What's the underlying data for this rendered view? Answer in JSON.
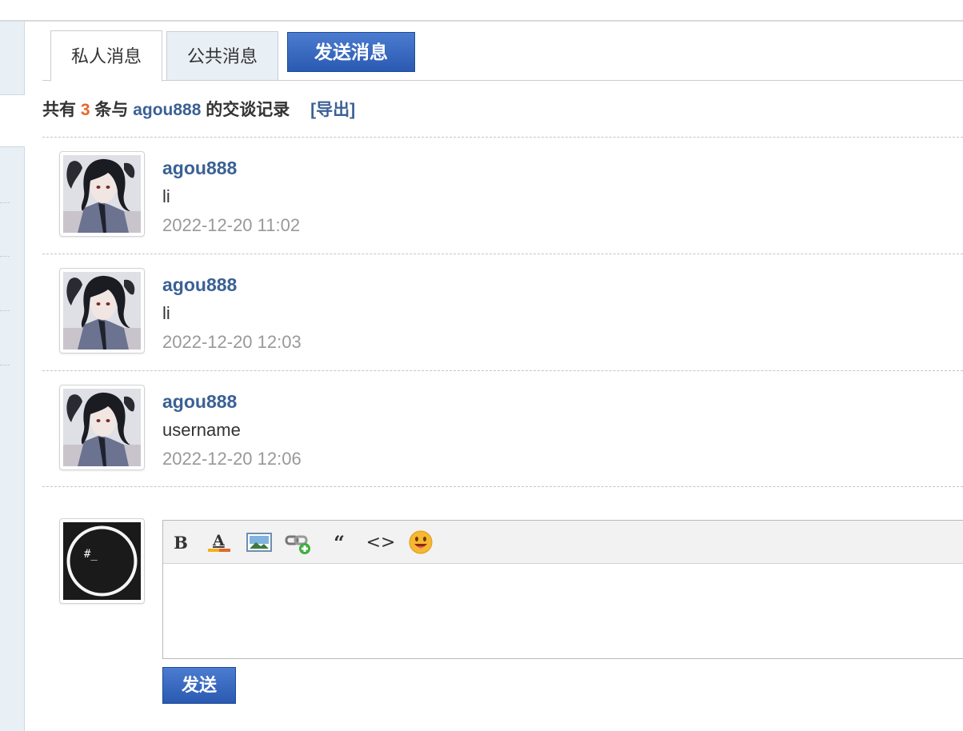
{
  "tabs": {
    "private": "私人消息",
    "public": "公共消息",
    "send_message": "发送消息"
  },
  "summary": {
    "prefix": "共有",
    "count": "3",
    "middle": "条与",
    "username": "agou888",
    "suffix": "的交谈记录",
    "export_label": "[导出]"
  },
  "messages": [
    {
      "author": "agou888",
      "text": "li",
      "time": "2022-12-20 11:02"
    },
    {
      "author": "agou888",
      "text": "li",
      "time": "2022-12-20 12:03"
    },
    {
      "author": "agou888",
      "text": "username",
      "time": "2022-12-20 12:06"
    }
  ],
  "my_avatar": {
    "text": "#_"
  },
  "editor": {
    "toolbar": [
      "bold-icon",
      "font-color-icon",
      "image-icon",
      "link-icon",
      "quote-icon",
      "code-icon",
      "emoji-icon"
    ],
    "bold_glyph": "B",
    "color_glyph": "A",
    "quote_glyph": "“",
    "code_glyph": "<>",
    "text_color_accent": "#e4682d"
  },
  "reply": {
    "send_label": "发送"
  },
  "colors": {
    "link_blue": "#3b6194",
    "count_orange": "#e4682d",
    "button_blue": "#2a5ab1",
    "time_gray": "#999999"
  }
}
